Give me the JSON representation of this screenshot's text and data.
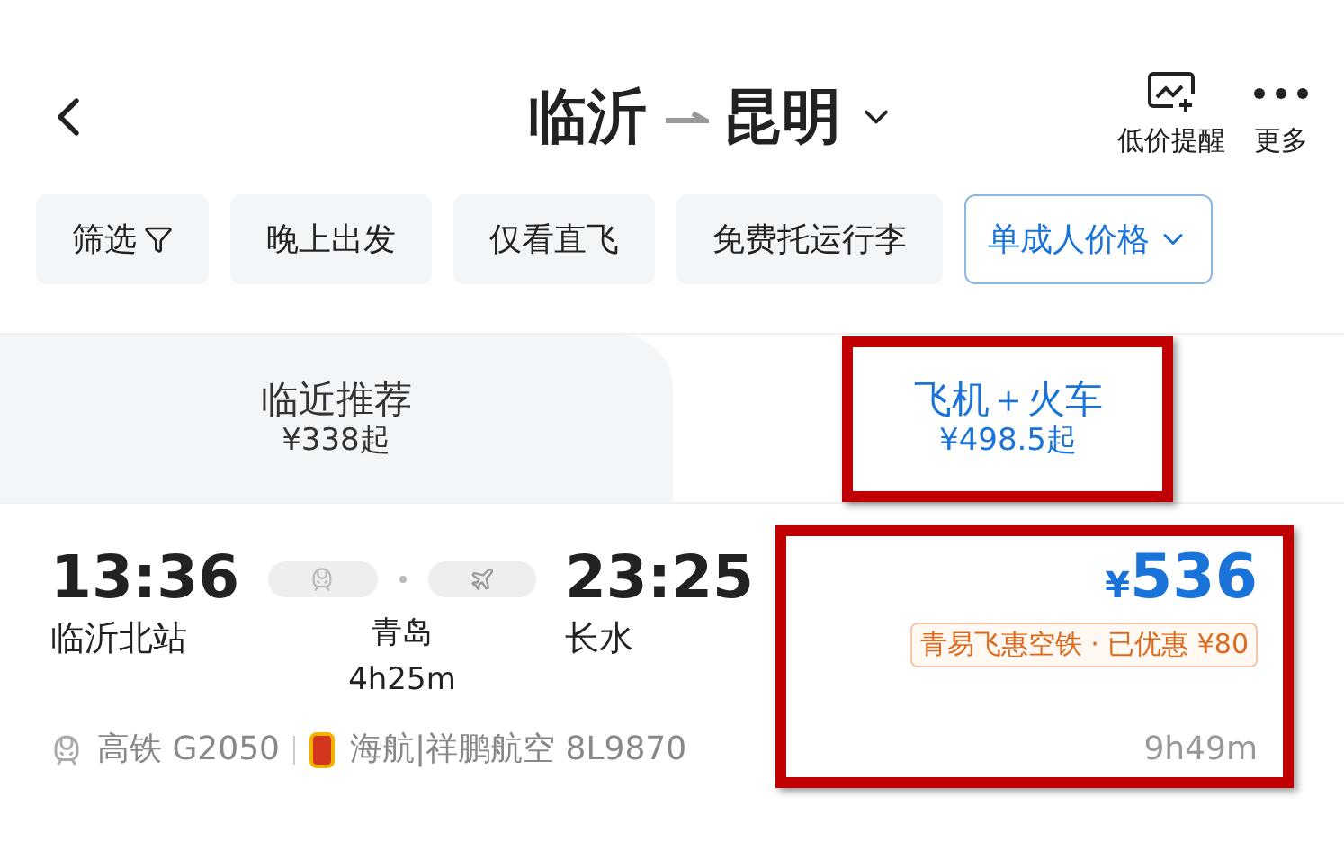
{
  "header": {
    "from": "临沂",
    "to": "昆明",
    "actions": [
      {
        "kind": "alert",
        "label": "低价提醒"
      },
      {
        "kind": "more",
        "label": "更多"
      }
    ]
  },
  "filters": [
    {
      "kind": "filter",
      "label": "筛选"
    },
    {
      "kind": "chip",
      "label": "晚上出发"
    },
    {
      "kind": "chip",
      "label": "仅看直飞"
    },
    {
      "kind": "chip",
      "label": "免费托运行李"
    },
    {
      "kind": "dropdown",
      "label": "单成人价格"
    }
  ],
  "tabs": [
    {
      "title": "临近推荐",
      "price": "¥338起",
      "selected": false,
      "highlighted": false
    },
    {
      "title": "飞机＋火车",
      "price": "¥498.5起",
      "selected": true,
      "highlighted": true
    }
  ],
  "trip": {
    "depart_time": "13:36",
    "depart_station": "临沂北站",
    "transfer_city": "青岛",
    "transfer_duration": "4h25m",
    "arrive_time": "23:25",
    "arrive_station": "长水",
    "currency": "¥",
    "price": "536",
    "promo": "青易飞惠空铁 · 已优惠 ¥80",
    "total_duration": "9h49m",
    "price_highlighted": true,
    "legs": [
      {
        "kind": "train",
        "text": "高铁 G2050"
      },
      {
        "kind": "flight",
        "text": "海航|祥鹏航空 8L9870"
      }
    ]
  }
}
